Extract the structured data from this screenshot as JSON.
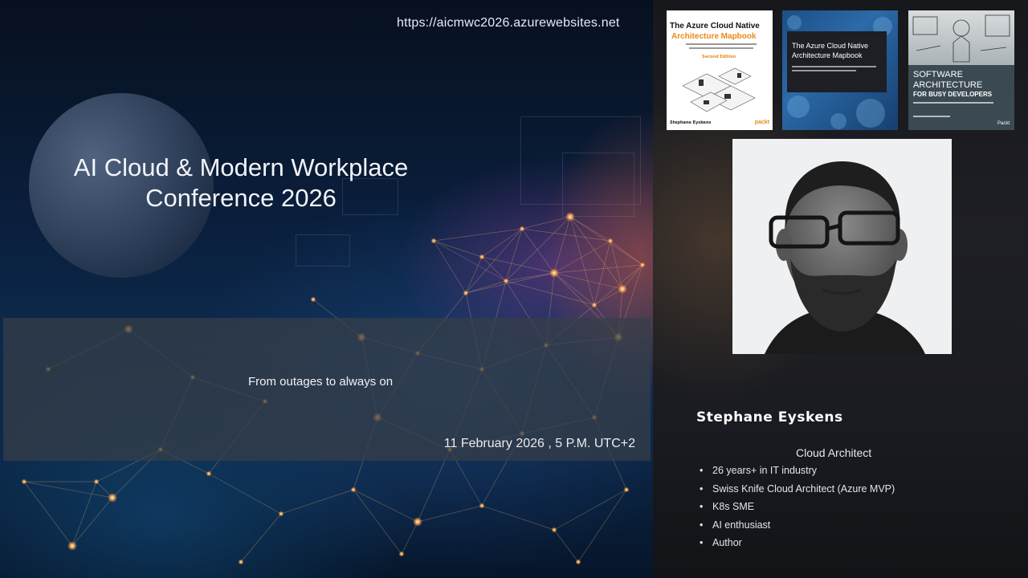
{
  "slide": {
    "url": "https://aicmwc2026.azurewebsites.net",
    "title_line1": "AI Cloud & Modern Workplace",
    "title_line2": "Conference 2026",
    "tagline": "From outages to always on",
    "date": "11 February 2026 , 5 P.M. UTC+2"
  },
  "books": [
    {
      "title": "The Azure Cloud Native",
      "subtitle": "Architecture Mapbook",
      "edition": "Second Edition",
      "author": "Stephane Eyskens",
      "publisher": "packt"
    },
    {
      "title_line1": "The Azure Cloud Native",
      "title_line2": "Architecture Mapbook"
    },
    {
      "title_line1": "SOFTWARE",
      "title_line2": "ARCHITECTURE",
      "title_line3": "FOR BUSY DEVELOPERS",
      "publisher": "Packt"
    }
  ],
  "speaker": {
    "name": "Stephane Eyskens",
    "role": "Cloud Architect",
    "facts": [
      "26 years+ in IT industry",
      "Swiss Knife Cloud Architect (Azure MVP)",
      "K8s SME",
      "AI enthusiast",
      "Author"
    ]
  },
  "colors": {
    "slide_background": "#0a1d3a",
    "band": "#373e48",
    "right_panel": "#1e1f24",
    "packt_orange": "#e88a1a",
    "network_glow": "#ffb45a"
  },
  "icons": {
    "photo": "speaker-portrait"
  }
}
